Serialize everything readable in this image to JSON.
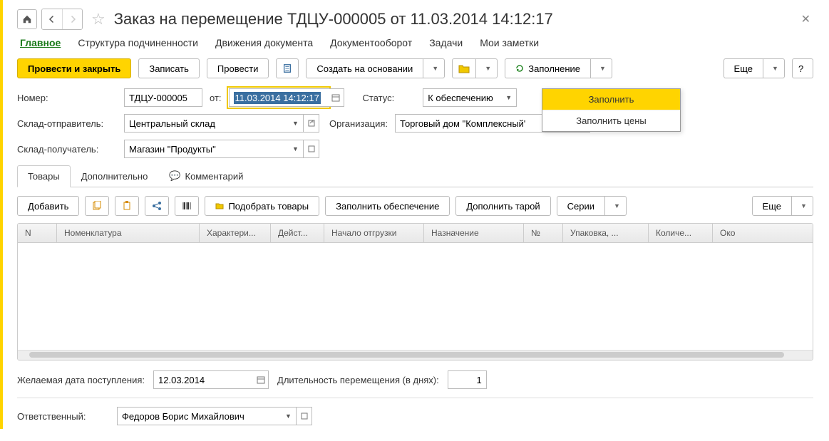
{
  "header": {
    "title": "Заказ на перемещение ТДЦУ-000005 от 11.03.2014 14:12:17"
  },
  "mainTabs": [
    "Главное",
    "Структура подчиненности",
    "Движения документа",
    "Документооборот",
    "Задачи",
    "Мои заметки"
  ],
  "toolbar": {
    "post_close": "Провести и закрыть",
    "write": "Записать",
    "post": "Провести",
    "create_based": "Создать на основании",
    "filling": "Заполнение",
    "more": "Еще",
    "help": "?"
  },
  "dropdown": {
    "item1": "Заполнить",
    "item2": "Заполнить цены"
  },
  "form": {
    "number_label": "Номер:",
    "number_value": "ТДЦУ-000005",
    "from_label": "от:",
    "date_value": "11.03.2014 14:12:17",
    "status_label": "Статус:",
    "status_value": "К обеспечению",
    "sender_label": "Склад-отправитель:",
    "sender_value": "Центральный склад",
    "org_label": "Организация:",
    "org_value": "Торговый дом \"Комплексный\"",
    "receiver_label": "Склад-получатель:",
    "receiver_value": "Магазин \"Продукты\""
  },
  "subTabs": {
    "goods": "Товары",
    "additional": "Дополнительно",
    "comment": "Комментарий"
  },
  "subToolbar": {
    "add": "Добавить",
    "pick": "Подобрать товары",
    "fill_supply": "Заполнить обеспечение",
    "add_tare": "Дополнить тарой",
    "series": "Серии",
    "more": "Еще"
  },
  "table": {
    "columns": [
      "N",
      "Номенклатура",
      "Характери...",
      "Дейст...",
      "Начало отгрузки",
      "Назначение",
      "№",
      "Упаковка, ...",
      "Количе...",
      "Око"
    ]
  },
  "footer": {
    "desired_date_label": "Желаемая дата поступления:",
    "desired_date_value": "12.03.2014",
    "duration_label": "Длительность перемещения (в днях):",
    "duration_value": "1",
    "responsible_label": "Ответственный:",
    "responsible_value": "Федоров Борис Михайлович"
  }
}
